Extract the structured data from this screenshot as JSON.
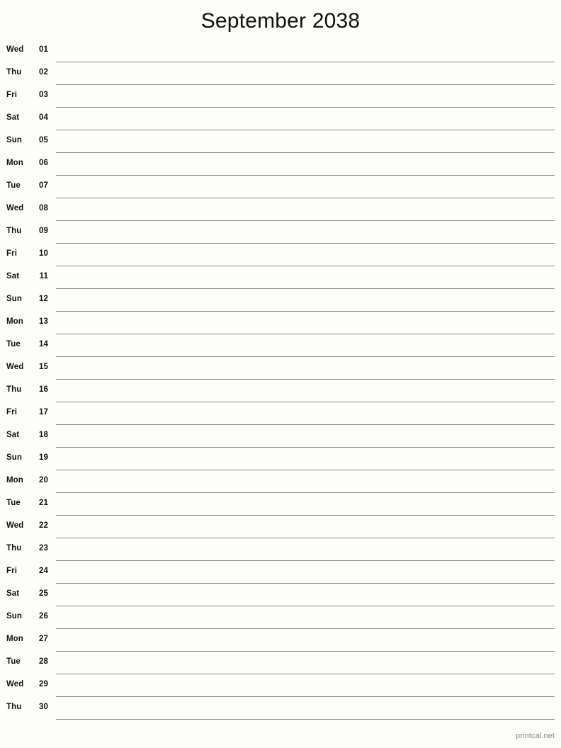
{
  "title": "September 2038",
  "footer": {
    "credit": "printcal.net"
  },
  "colors": {
    "background": "#fdfdfa",
    "text": "#111111",
    "rule": "#8a8a82",
    "footer_text": "#8a8a84"
  },
  "days": [
    {
      "weekday": "Wed",
      "date": "01"
    },
    {
      "weekday": "Thu",
      "date": "02"
    },
    {
      "weekday": "Fri",
      "date": "03"
    },
    {
      "weekday": "Sat",
      "date": "04"
    },
    {
      "weekday": "Sun",
      "date": "05"
    },
    {
      "weekday": "Mon",
      "date": "06"
    },
    {
      "weekday": "Tue",
      "date": "07"
    },
    {
      "weekday": "Wed",
      "date": "08"
    },
    {
      "weekday": "Thu",
      "date": "09"
    },
    {
      "weekday": "Fri",
      "date": "10"
    },
    {
      "weekday": "Sat",
      "date": "11"
    },
    {
      "weekday": "Sun",
      "date": "12"
    },
    {
      "weekday": "Mon",
      "date": "13"
    },
    {
      "weekday": "Tue",
      "date": "14"
    },
    {
      "weekday": "Wed",
      "date": "15"
    },
    {
      "weekday": "Thu",
      "date": "16"
    },
    {
      "weekday": "Fri",
      "date": "17"
    },
    {
      "weekday": "Sat",
      "date": "18"
    },
    {
      "weekday": "Sun",
      "date": "19"
    },
    {
      "weekday": "Mon",
      "date": "20"
    },
    {
      "weekday": "Tue",
      "date": "21"
    },
    {
      "weekday": "Wed",
      "date": "22"
    },
    {
      "weekday": "Thu",
      "date": "23"
    },
    {
      "weekday": "Fri",
      "date": "24"
    },
    {
      "weekday": "Sat",
      "date": "25"
    },
    {
      "weekday": "Sun",
      "date": "26"
    },
    {
      "weekday": "Mon",
      "date": "27"
    },
    {
      "weekday": "Tue",
      "date": "28"
    },
    {
      "weekday": "Wed",
      "date": "29"
    },
    {
      "weekday": "Thu",
      "date": "30"
    }
  ]
}
